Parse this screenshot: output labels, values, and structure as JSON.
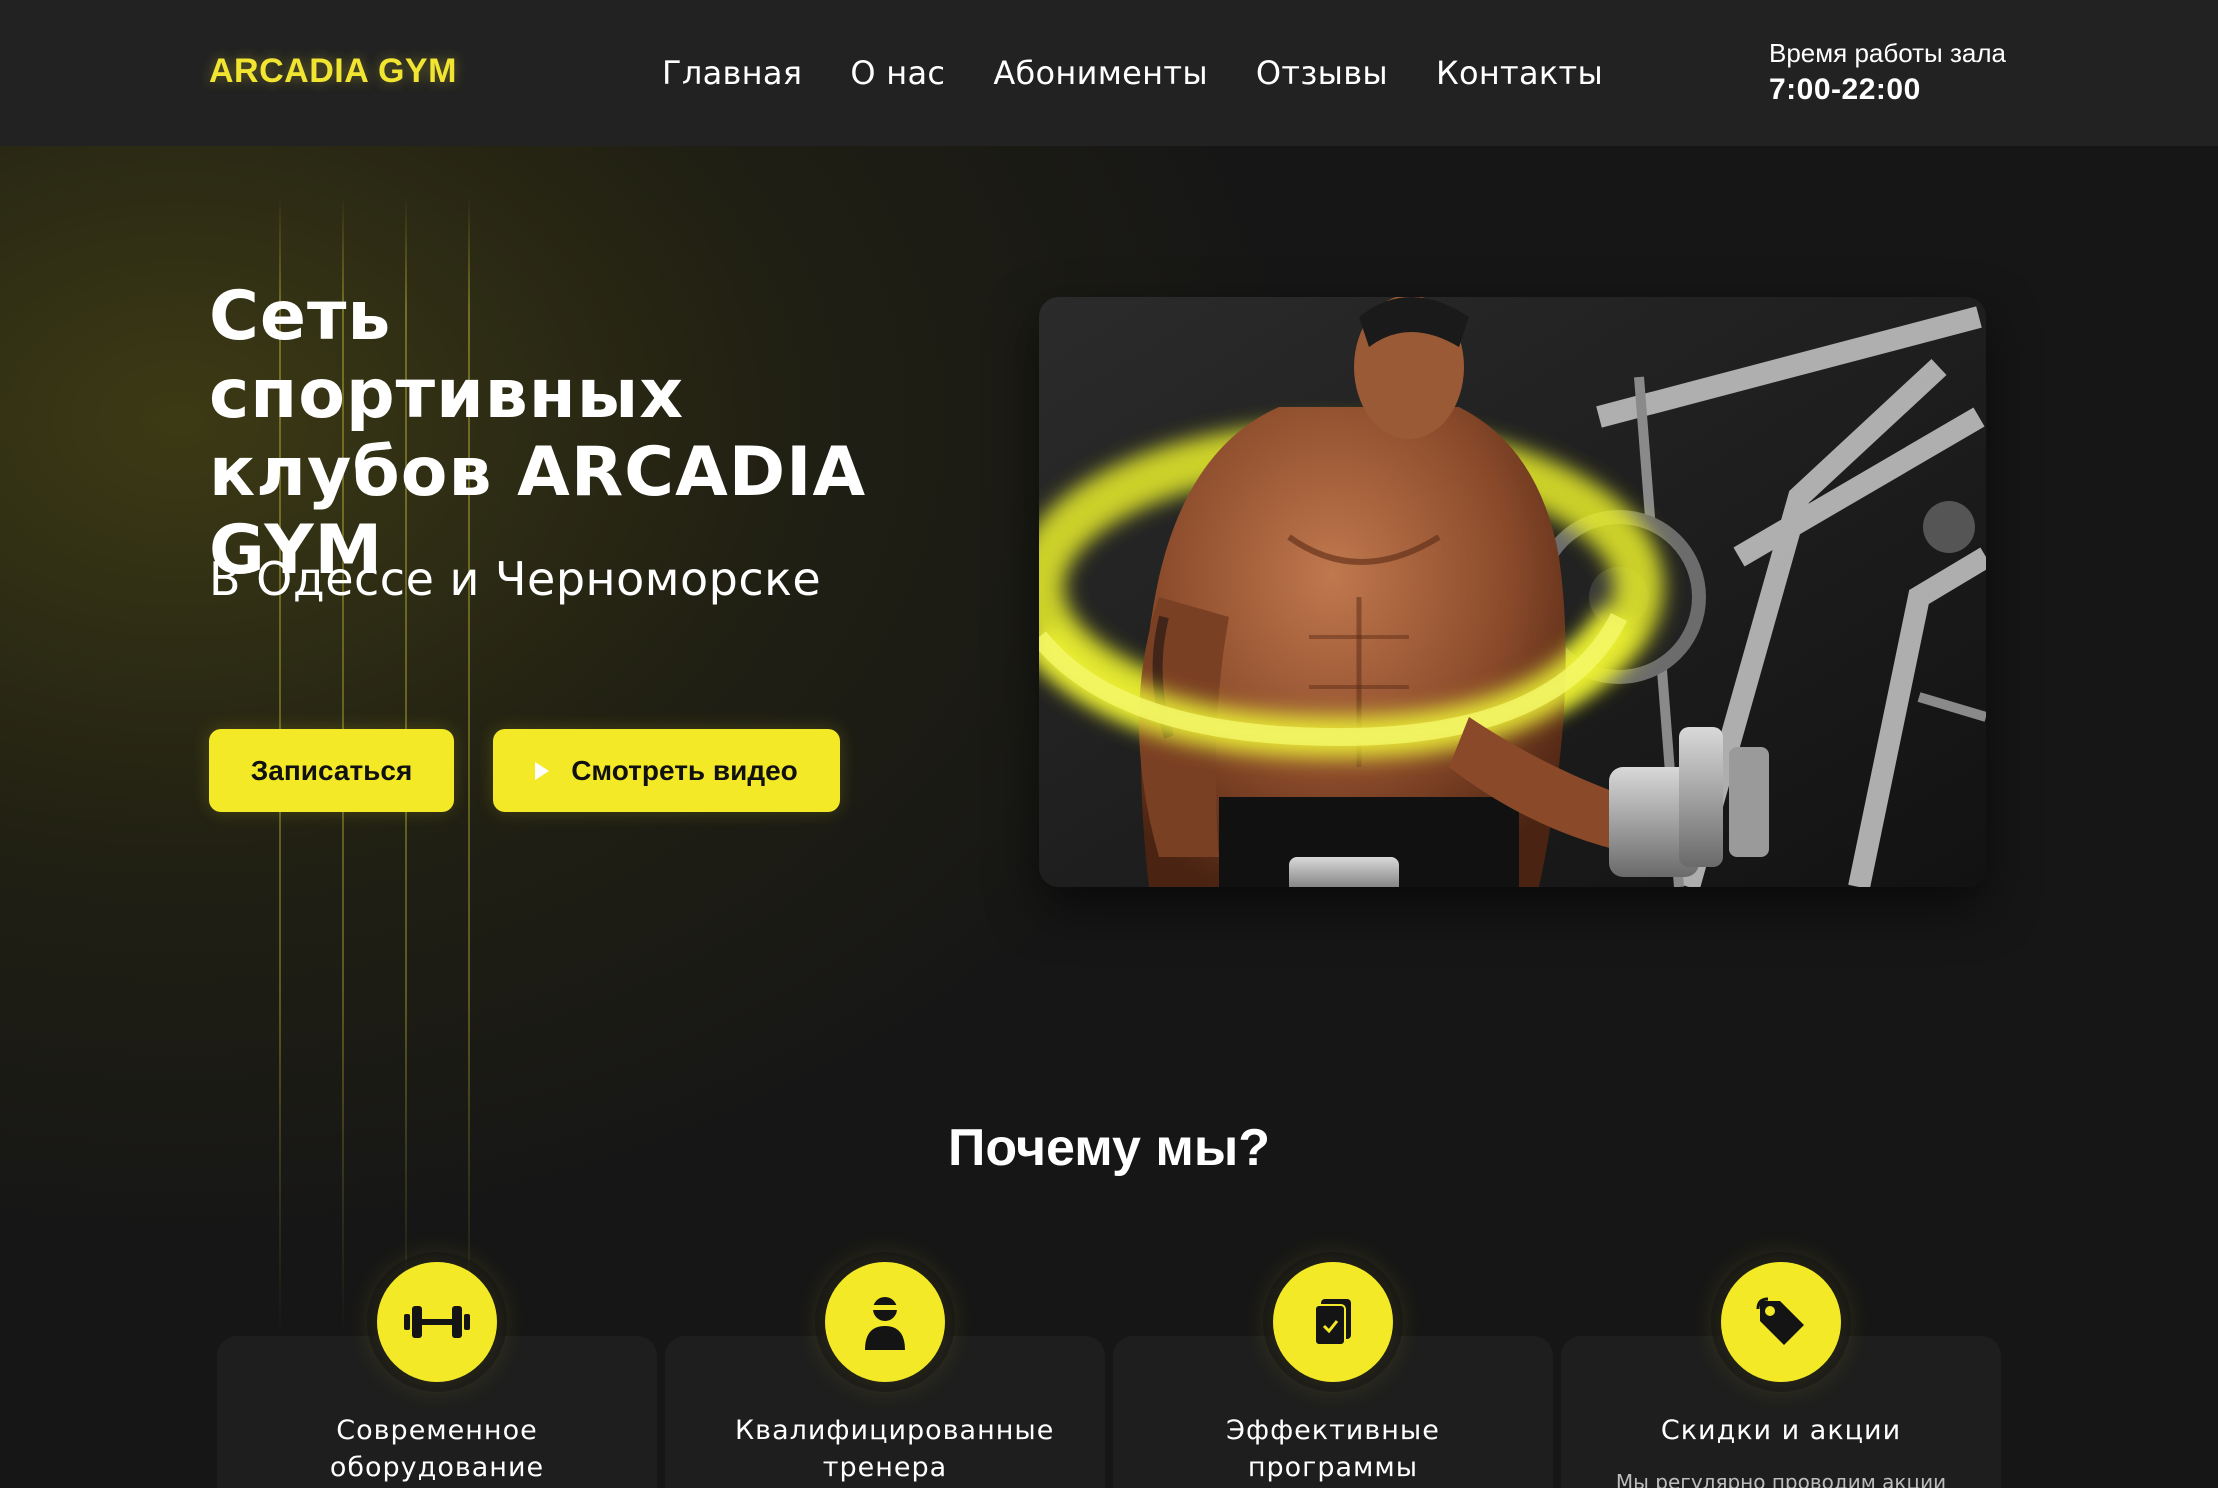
{
  "header": {
    "logo": "ARCADIA GYM",
    "nav": [
      "Главная",
      "О нас",
      "Абонименты",
      "Отзывы",
      "Контакты"
    ],
    "hours_label": "Время работы зала",
    "hours_value": "7:00-22:00"
  },
  "hero": {
    "title": "Сеть спортивных клубов ARCADIA GYM",
    "subtitle": "В Одессе и Черноморске",
    "signup_button": "Записаться",
    "video_button": "Смотреть видео",
    "image_subject": "muscular-man-with-dumbbells"
  },
  "why": {
    "title": "Почему мы?",
    "cards": [
      {
        "icon": "dumbbell-icon",
        "title": "Современное оборудование",
        "description": ""
      },
      {
        "icon": "trainer-icon",
        "title": "Квалифицированные тренера",
        "description": ""
      },
      {
        "icon": "program-icon",
        "title": "Эффективные программы",
        "description": ""
      },
      {
        "icon": "discount-tag-icon",
        "title": "Скидки и акции",
        "description": "Мы регулярно проводим акции"
      }
    ]
  },
  "colors": {
    "accent": "#f3e927",
    "header_bg": "#222222",
    "page_bg": "#161616",
    "card_bg": "#1e1e1e"
  }
}
